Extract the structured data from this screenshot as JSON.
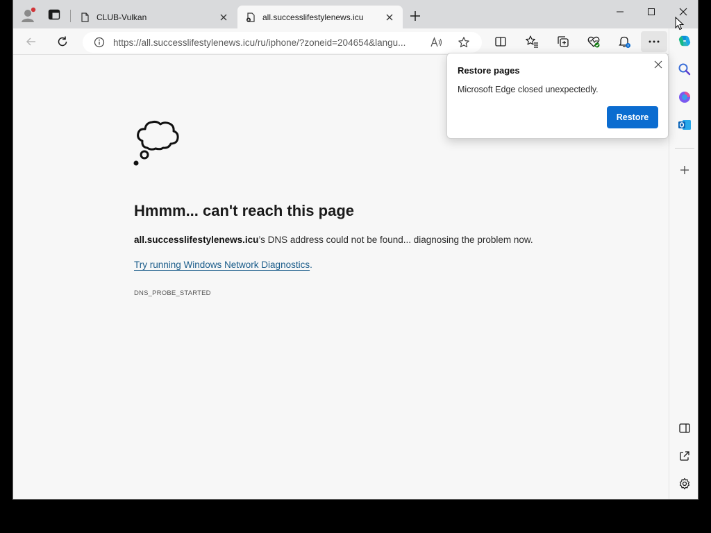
{
  "tabs": [
    {
      "label": "CLUB-Vulkan",
      "active": false
    },
    {
      "label": "all.successlifestylenews.icu",
      "active": true
    }
  ],
  "address_bar": {
    "url": "https://all.successlifestylenews.icu/ru/iphone/?zoneid=204654&langu..."
  },
  "error_page": {
    "title": "Hmmm... can't reach this page",
    "domain": "all.successlifestylenews.icu",
    "description_suffix": "’s DNS address could not be found... diagnosing the problem now.",
    "link_text": "Try running Windows Network Diagnostics",
    "link_suffix": ".",
    "error_code": "DNS_PROBE_STARTED"
  },
  "restore_popup": {
    "title": "Restore pages",
    "message": "Microsoft Edge closed unexpectedly.",
    "button_label": "Restore"
  },
  "colors": {
    "accent": "#0b6cd0",
    "link": "#1a5c8a",
    "tabbar": "#d9dadc",
    "page_bg": "#f7f7f7"
  },
  "icons": [
    "profile-icon",
    "tab-actions-icon",
    "page-icon",
    "close-icon",
    "new-tab-icon",
    "minimize-icon",
    "maximize-icon",
    "back-icon",
    "refresh-icon",
    "info-icon",
    "read-aloud-icon",
    "favorite-star-icon",
    "split-screen-icon",
    "favorites-icon",
    "collections-icon",
    "browser-essentials-icon",
    "notifications-icon",
    "more-icon",
    "copilot-icon",
    "search-icon",
    "m365-icon",
    "outlook-icon",
    "add-icon",
    "hide-sidebar-icon",
    "external-link-icon",
    "settings-icon",
    "thought-cloud-icon"
  ]
}
